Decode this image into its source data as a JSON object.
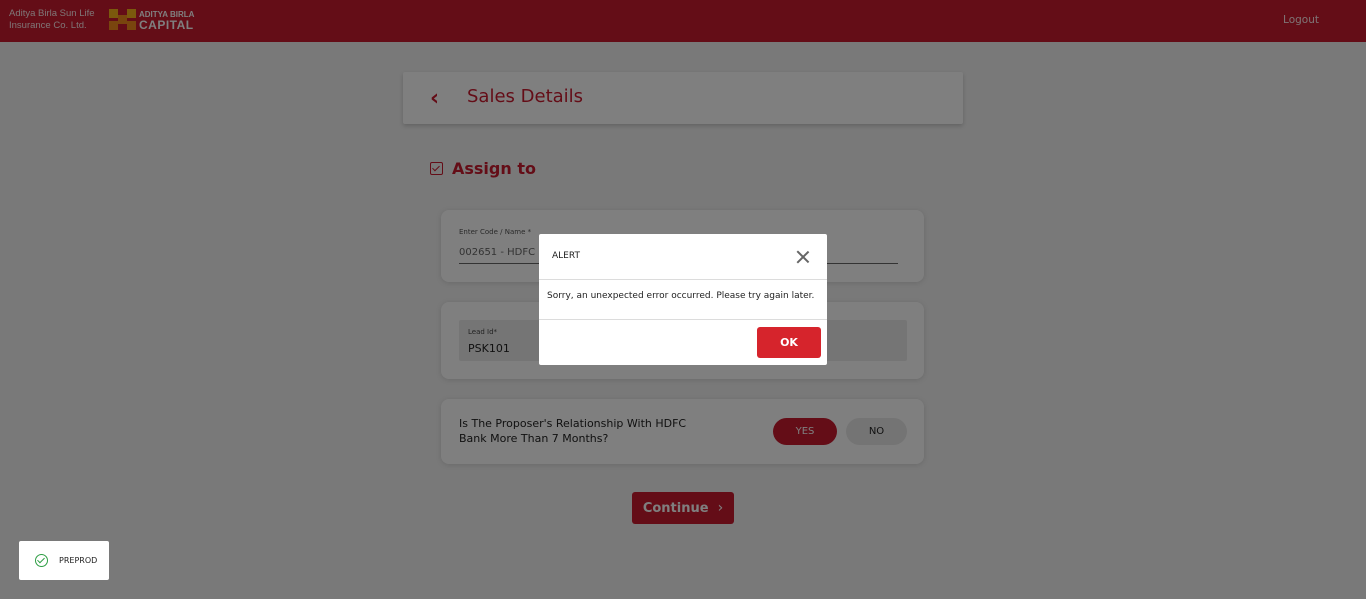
{
  "header": {
    "brand_line1": "Aditya Birla Sun Life",
    "brand_line2": "Insurance Co. Ltd.",
    "logo_line1": "ADITYA BIRLA",
    "logo_line2": "CAPITAL",
    "logout_label": "Logout"
  },
  "page": {
    "title": "Sales Details",
    "section_title": "Assign to"
  },
  "form": {
    "code_label": "Enter Code / Name *",
    "code_value": "002651 - HDFC B",
    "lead_label": "Lead Id*",
    "lead_value": "PSK101",
    "relationship_question": "Is The Proposer's Relationship With HDFC Bank More Than 7 Months?",
    "yes_label": "YES",
    "no_label": "NO",
    "selected_option": "YES",
    "continue_label": "Continue"
  },
  "alert": {
    "title": "ALERT",
    "message": "Sorry, an unexpected error occurred. Please try again later.",
    "ok_label": "OK"
  },
  "environment_badge": "PREPROD",
  "colors": {
    "brand_red": "#c91a2f",
    "success_green": "#2e9e44"
  }
}
